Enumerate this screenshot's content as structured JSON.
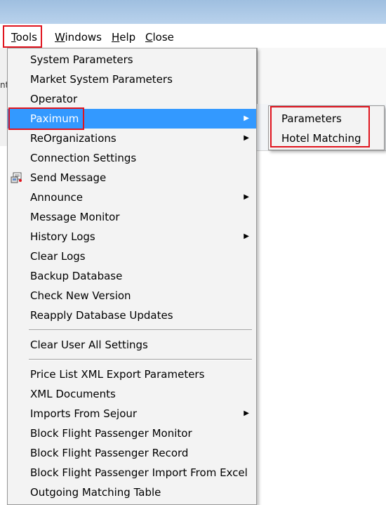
{
  "menubar": {
    "items": [
      {
        "label_prefix": "",
        "underline": "T",
        "label_rest": "ools"
      },
      {
        "label_prefix": "",
        "underline": "W",
        "label_rest": "indows"
      },
      {
        "label_prefix": "",
        "underline": "H",
        "label_rest": "elp"
      },
      {
        "label_prefix": "",
        "underline": "C",
        "label_rest": "lose"
      }
    ]
  },
  "left_edge_fragment": "nt",
  "tools_menu": {
    "items": [
      {
        "label": "System Parameters"
      },
      {
        "label": "Market System Parameters"
      },
      {
        "label": "Operator"
      },
      {
        "label": "Paximum",
        "submenu": true
      },
      {
        "label": "ReOrganizations",
        "submenu": true
      },
      {
        "label": "Connection Settings"
      },
      {
        "label": "Send Message",
        "icon": "send-message-icon"
      },
      {
        "label": "Announce",
        "submenu": true
      },
      {
        "label": "Message Monitor"
      },
      {
        "label": "History Logs",
        "submenu": true
      },
      {
        "label": "Clear Logs"
      },
      {
        "label": "Backup Database"
      },
      {
        "label": "Check New Version"
      },
      {
        "label": "Reapply Database Updates"
      },
      {
        "label": "Clear User All Settings"
      },
      {
        "label": "Price List XML Export Parameters"
      },
      {
        "label": "XML Documents"
      },
      {
        "label": "Imports From Sejour",
        "submenu": true
      },
      {
        "label": "Block Flight Passenger Monitor"
      },
      {
        "label": "Block Flight Passenger Record"
      },
      {
        "label": "Block Flight Passenger Import From Excel"
      },
      {
        "label": "Outgoing Matching Table"
      }
    ],
    "submenu_arrow": "▶"
  },
  "paximum_submenu": {
    "items": [
      {
        "label": "Parameters"
      },
      {
        "label": "Hotel Matching"
      }
    ]
  },
  "colors": {
    "highlight": "#3399ff",
    "annotation_red": "#e0141e",
    "menu_background": "#f3f3f3"
  }
}
